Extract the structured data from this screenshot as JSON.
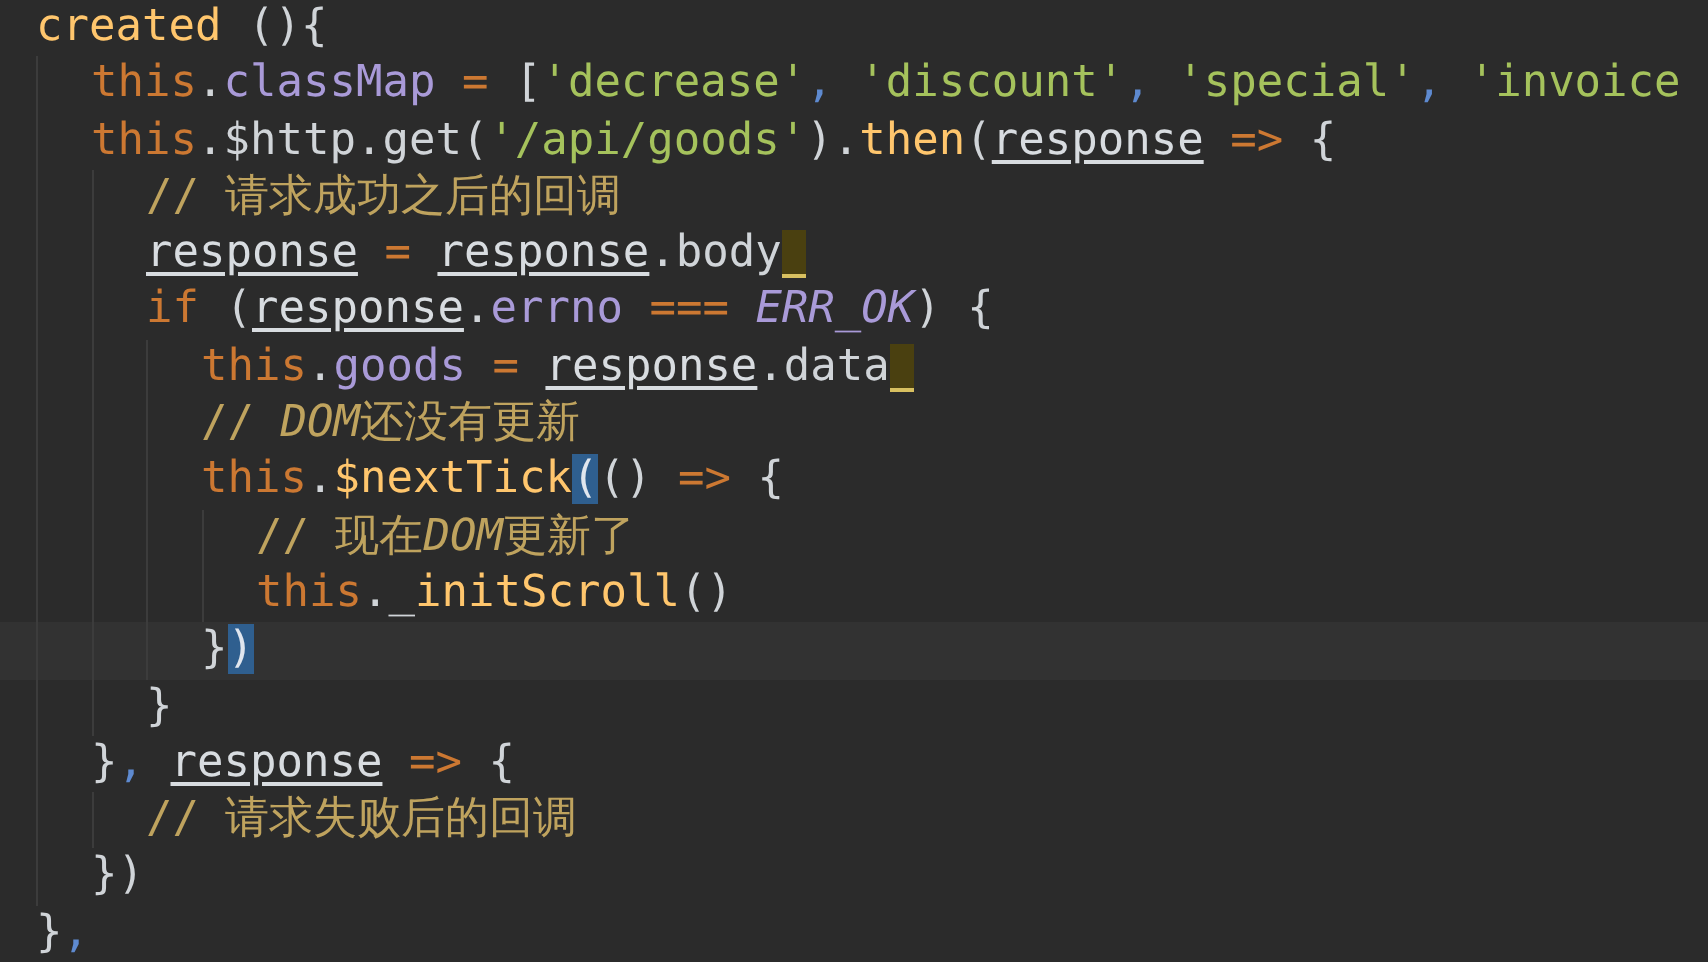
{
  "editor": {
    "lines": [
      {
        "current": false,
        "warning": false,
        "tokens": [
          {
            "kind": "func",
            "text": "created"
          },
          {
            "kind": "plain",
            "text": " (){"
          }
        ]
      },
      {
        "current": false,
        "warning": false,
        "tokens": [
          {
            "kind": "keyword",
            "text": "  this"
          },
          {
            "kind": "plain",
            "text": "."
          },
          {
            "kind": "prop",
            "text": "classMap"
          },
          {
            "kind": "keyword",
            "text": " = "
          },
          {
            "kind": "plain",
            "text": "["
          },
          {
            "kind": "string",
            "text": "'decrease'"
          },
          {
            "kind": "comma",
            "text": ", "
          },
          {
            "kind": "string",
            "text": "'discount'"
          },
          {
            "kind": "comma",
            "text": ", "
          },
          {
            "kind": "string",
            "text": "'special'"
          },
          {
            "kind": "comma",
            "text": ", "
          },
          {
            "kind": "string",
            "text": "'invoice"
          }
        ]
      },
      {
        "current": false,
        "warning": false,
        "tokens": [
          {
            "kind": "keyword",
            "text": "  this"
          },
          {
            "kind": "plain",
            "text": ".$http.get("
          },
          {
            "kind": "string",
            "text": "'/api/goods'"
          },
          {
            "kind": "plain",
            "text": ")."
          },
          {
            "kind": "func",
            "text": "then"
          },
          {
            "kind": "plain",
            "text": "("
          },
          {
            "kind": "param",
            "text": "response"
          },
          {
            "kind": "keyword",
            "text": " =>"
          },
          {
            "kind": "plain",
            "text": " {"
          }
        ]
      },
      {
        "current": false,
        "warning": false,
        "tokens": [
          {
            "kind": "comment",
            "text": "    // 请求成功之后的回调"
          }
        ]
      },
      {
        "current": false,
        "warning": true,
        "tokens": [
          {
            "kind": "param",
            "text": "    response"
          },
          {
            "kind": "keyword",
            "text": " = "
          },
          {
            "kind": "param",
            "text": "response"
          },
          {
            "kind": "plain",
            "text": ".body"
          }
        ]
      },
      {
        "current": false,
        "warning": false,
        "tokens": [
          {
            "kind": "keyword",
            "text": "    if"
          },
          {
            "kind": "plain",
            "text": " ("
          },
          {
            "kind": "param",
            "text": "response"
          },
          {
            "kind": "plain",
            "text": "."
          },
          {
            "kind": "prop",
            "text": "errno"
          },
          {
            "kind": "keyword",
            "text": " === "
          },
          {
            "kind": "constant",
            "text": "ERR_OK"
          },
          {
            "kind": "plain",
            "text": ") {"
          }
        ]
      },
      {
        "current": false,
        "warning": true,
        "tokens": [
          {
            "kind": "keyword",
            "text": "      this"
          },
          {
            "kind": "plain",
            "text": "."
          },
          {
            "kind": "prop",
            "text": "goods"
          },
          {
            "kind": "keyword",
            "text": " = "
          },
          {
            "kind": "param",
            "text": "response"
          },
          {
            "kind": "plain",
            "text": ".data"
          }
        ]
      },
      {
        "current": false,
        "warning": false,
        "tokens": [
          {
            "kind": "comment",
            "text": "      // "
          },
          {
            "kind": "comment_em",
            "text": "DOM"
          },
          {
            "kind": "comment",
            "text": "还没有更新"
          }
        ]
      },
      {
        "current": false,
        "warning": false,
        "tokens": [
          {
            "kind": "keyword",
            "text": "      this"
          },
          {
            "kind": "plain",
            "text": "."
          },
          {
            "kind": "func",
            "text": "$nextTick"
          },
          {
            "kind": "match",
            "text": "("
          },
          {
            "kind": "plain",
            "text": "()"
          },
          {
            "kind": "keyword",
            "text": " =>"
          },
          {
            "kind": "plain",
            "text": " {"
          }
        ]
      },
      {
        "current": false,
        "warning": false,
        "tokens": [
          {
            "kind": "comment",
            "text": "        // 现在"
          },
          {
            "kind": "comment_em",
            "text": "DOM"
          },
          {
            "kind": "comment",
            "text": "更新了"
          }
        ]
      },
      {
        "current": false,
        "warning": false,
        "tokens": [
          {
            "kind": "keyword",
            "text": "        this"
          },
          {
            "kind": "plain",
            "text": "._"
          },
          {
            "kind": "func",
            "text": "initScroll"
          },
          {
            "kind": "plain",
            "text": "()"
          }
        ]
      },
      {
        "current": true,
        "warning": false,
        "tokens": [
          {
            "kind": "plain",
            "text": "      }"
          },
          {
            "kind": "match",
            "text": ")"
          }
        ]
      },
      {
        "current": false,
        "warning": false,
        "tokens": [
          {
            "kind": "plain",
            "text": "    }"
          }
        ]
      },
      {
        "current": false,
        "warning": false,
        "tokens": [
          {
            "kind": "plain",
            "text": "  }"
          },
          {
            "kind": "comma",
            "text": ", "
          },
          {
            "kind": "param",
            "text": "response"
          },
          {
            "kind": "keyword",
            "text": " =>"
          },
          {
            "kind": "plain",
            "text": " {"
          }
        ]
      },
      {
        "current": false,
        "warning": false,
        "tokens": [
          {
            "kind": "comment",
            "text": "    // 请求失败后的回调"
          }
        ]
      },
      {
        "current": false,
        "warning": false,
        "tokens": [
          {
            "kind": "plain",
            "text": "  })"
          }
        ]
      },
      {
        "current": false,
        "warning": false,
        "tokens": [
          {
            "kind": "plain",
            "text": "}"
          },
          {
            "kind": "comma",
            "text": ","
          }
        ]
      }
    ]
  }
}
